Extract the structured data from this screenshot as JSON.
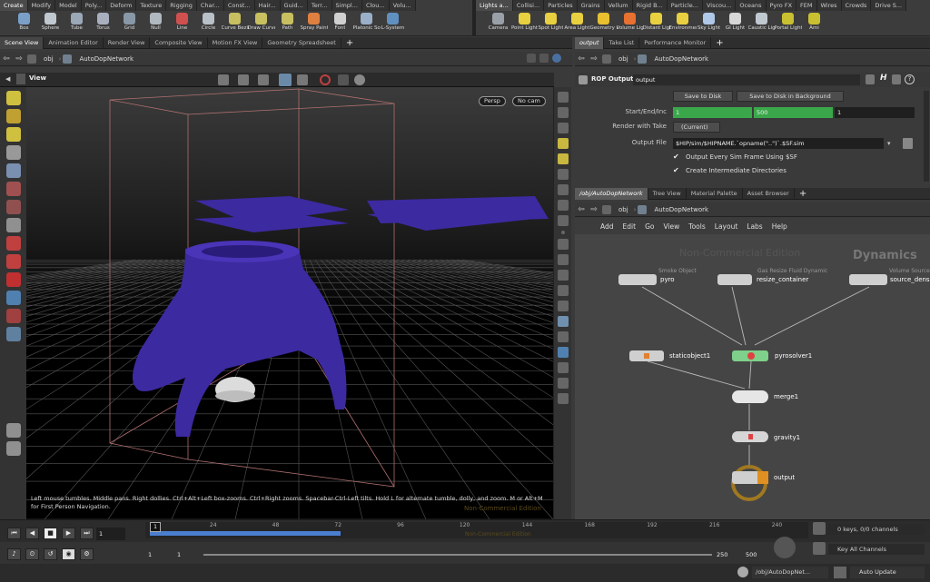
{
  "shelf": {
    "tabs_left": [
      "Create",
      "Modify",
      "Model",
      "Poly...",
      "Deform",
      "Texture",
      "Rigging",
      "Char...",
      "Const...",
      "Hair...",
      "Guid...",
      "Terr...",
      "Simpl...",
      "Clou...",
      "Volu..."
    ],
    "tabs_right": [
      "Lights a...",
      "Collisi...",
      "Particles",
      "Grains",
      "Vellum",
      "Rigid B...",
      "Particle...",
      "Viscou...",
      "Oceans",
      "Pyro FX",
      "FEM",
      "Wires",
      "Crowds",
      "Drive S..."
    ],
    "tools_left": [
      {
        "label": "Box",
        "color": "#7aa0c8"
      },
      {
        "label": "Sphere",
        "color": "#c0c8d0"
      },
      {
        "label": "Tube",
        "color": "#9aa8b8"
      },
      {
        "label": "Torus",
        "color": "#a8b0c0"
      },
      {
        "label": "Grid",
        "color": "#8898a8"
      },
      {
        "label": "Null",
        "color": "#b0b8c0"
      },
      {
        "label": "Line",
        "color": "#d05050"
      },
      {
        "label": "Circle",
        "color": "#b8c0c8"
      },
      {
        "label": "Curve Bezier",
        "color": "#c8c060"
      },
      {
        "label": "Draw Curve",
        "color": "#c8c060"
      },
      {
        "label": "Path",
        "color": "#c8c060"
      },
      {
        "label": "Spray Paint",
        "color": "#e08040"
      },
      {
        "label": "Font",
        "color": "#d0d0d0"
      },
      {
        "label": "Platonic Solids",
        "color": "#9ab0c8"
      },
      {
        "label": "L-System",
        "color": "#6090c0"
      }
    ],
    "tools_right": [
      {
        "label": "Camera",
        "color": "#9aa0a8"
      },
      {
        "label": "Point Light",
        "color": "#e8d040"
      },
      {
        "label": "Spot Light",
        "color": "#e8d040"
      },
      {
        "label": "Area Light",
        "color": "#e8d040"
      },
      {
        "label": "Geometry Light",
        "color": "#e8c030"
      },
      {
        "label": "Volume Light",
        "color": "#e87030"
      },
      {
        "label": "Distant Light",
        "color": "#e8d040"
      },
      {
        "label": "Environment Light",
        "color": "#e8d040"
      },
      {
        "label": "Sky Light",
        "color": "#b0c8e8"
      },
      {
        "label": "GI Light",
        "color": "#d8d8d8"
      },
      {
        "label": "Caustic Light",
        "color": "#c0c8d0"
      },
      {
        "label": "Portal Light",
        "color": "#c8c030"
      },
      {
        "label": "Ami",
        "color": "#c8c030"
      }
    ]
  },
  "left_pane": {
    "tabs": [
      "Scene View",
      "Animation Editor",
      "Render View",
      "Composite View",
      "Motion FX View",
      "Geometry Spreadsheet"
    ],
    "path_root": "obj",
    "path_node": "AutoDopNetwork",
    "view_label": "View",
    "persp": "Persp",
    "cam": "No cam",
    "watermark": "Non-Commercial Edition",
    "help_text": "Left mouse tumbles. Middle pans. Right dollies. Ctrl+Alt+Left box-zooms. Ctrl+Right zooms. Spacebar-Ctrl-Left tilts. Hold L for alternate tumble, dolly, and zoom. M or Alt+M for First Person Navigation."
  },
  "params": {
    "tabs": [
      "output",
      "Take List",
      "Performance Monitor"
    ],
    "path_root": "obj",
    "path_node": "AutoDopNetwork",
    "node_type": "ROP Output",
    "node_name": "output",
    "save_disk": "Save to Disk",
    "save_bg": "Save to Disk in Background",
    "start_label": "Start/End/Inc",
    "start": "1",
    "end": "500",
    "inc": "1",
    "take_label": "Render with Take",
    "take_value": "(Current)",
    "file_label": "Output File",
    "file_value": "$HIP/sim/$HIPNAME.`opname(\"..\")`.$SF.sim",
    "check1": "Output Every Sim Frame Using $SF",
    "check2": "Create Intermediate Directories"
  },
  "network": {
    "tabs": [
      "/obj/AutoDopNetwork",
      "Tree View",
      "Material Palette",
      "Asset Browser"
    ],
    "path_root": "obj",
    "path_node": "AutoDopNetwork",
    "menu": [
      "Add",
      "Edit",
      "Go",
      "View",
      "Tools",
      "Layout",
      "Labs",
      "Help"
    ],
    "watermark": "Non-Commercial Edition",
    "context": "Dynamics",
    "nodes": {
      "pyro": {
        "type": "Smoke Object",
        "name": "pyro"
      },
      "resize": {
        "type": "Gas Resize Fluid Dynamic",
        "name": "resize_container"
      },
      "source": {
        "type": "Volume Source",
        "name": "source_density"
      },
      "static": {
        "name": "staticobject1"
      },
      "solver": {
        "name": "pyrosolver1"
      },
      "merge": {
        "name": "merge1"
      },
      "gravity": {
        "name": "gravity1"
      },
      "output": {
        "name": "output"
      }
    }
  },
  "timeline": {
    "ticks": [
      "24",
      "48",
      "72",
      "96",
      "120",
      "144",
      "168",
      "192",
      "216",
      "240"
    ],
    "frame_marker": "1",
    "current_frame": "1",
    "range_start": "1",
    "range_start2": "1",
    "range_end": "250",
    "range_end2": "500",
    "keys": "0 keys, 0/0 channels",
    "key_all": "Key All Channels",
    "watermark": "Non-Commercial Edition",
    "status_path": "/obj/AutoDopNet...",
    "auto_update": "Auto Update"
  }
}
